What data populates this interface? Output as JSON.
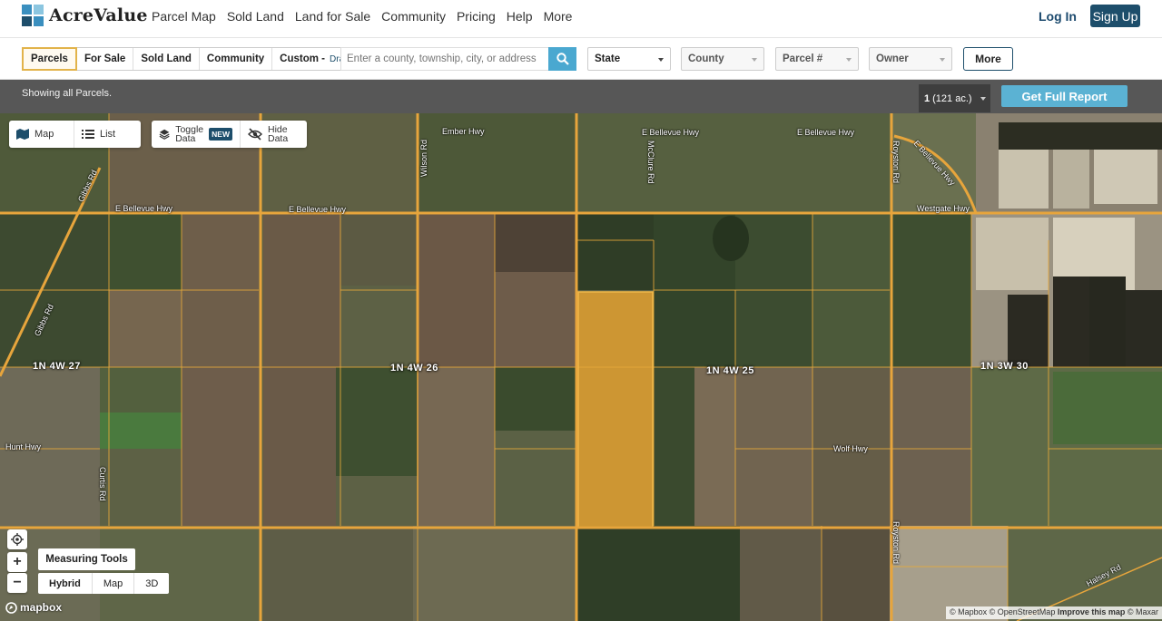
{
  "brand": {
    "name": "AcreValue"
  },
  "nav": {
    "items": [
      "Parcel Map",
      "Sold Land",
      "Land for Sale",
      "Community",
      "Pricing",
      "Help",
      "More"
    ],
    "login": "Log In",
    "signup": "Sign Up"
  },
  "filters": {
    "tabs": [
      "Parcels",
      "For Sale",
      "Sold Land",
      "Community"
    ],
    "custom_label": "Custom -",
    "draw_label": "Draw",
    "search_placeholder": "Enter a county, township, city, or address",
    "state": "State",
    "county": "County",
    "parcel": "Parcel #",
    "owner": "Owner",
    "more": "More"
  },
  "status": {
    "text": "Showing all Parcels.",
    "count": "1",
    "acres": "(121 ac.)",
    "report_button": "Get Full Report"
  },
  "map_controls": {
    "map": "Map",
    "list": "List",
    "toggle_line1": "Toggle",
    "toggle_line2": "Data",
    "new_badge": "NEW",
    "hide_line1": "Hide",
    "hide_line2": "Data",
    "zoom_in": "+",
    "zoom_out": "−",
    "measuring_tools": "Measuring Tools",
    "types": [
      "Hybrid",
      "Map",
      "3D"
    ],
    "selected_type": "Hybrid"
  },
  "map_labels": {
    "sections": [
      "1N 4W 27",
      "1N 4W 26",
      "1N 4W 25",
      "1N 3W 30"
    ],
    "roads": {
      "ember": "Ember Hwy",
      "bellevue1": "E Bellevue Hwy",
      "bellevue2": "E Bellevue Hwy",
      "bellevue3": "E Bellevue Hwy",
      "bellevue4": "E Bellevue Hwy",
      "bellevue5": "E Bellevue Hwy",
      "westgate": "Westgate Hwy",
      "wolf": "Wolf Hwy",
      "hunt": "Hunt Hwy",
      "royston1": "Royston Rd",
      "royston2": "Royston Rd",
      "mcclure": "McClure Rd",
      "wilson": "Wilson Rd",
      "gibbs1": "Gibbs Rd",
      "gibbs2": "Gibbs Rd",
      "curtis": "Curtis Rd",
      "halsey": "Halsey Rd"
    }
  },
  "attribution": {
    "mapbox_logo": "mapbox",
    "text1": "© Mapbox © OpenStreetMap",
    "improve": "Improve this map",
    "text2": "© Maxar"
  },
  "colors": {
    "accent": "#1d4e6b",
    "search": "#4aa8d0",
    "report": "#5bb2d3",
    "parcel_lines": "#e8a93a",
    "selected_parcel": "#e0a030"
  }
}
